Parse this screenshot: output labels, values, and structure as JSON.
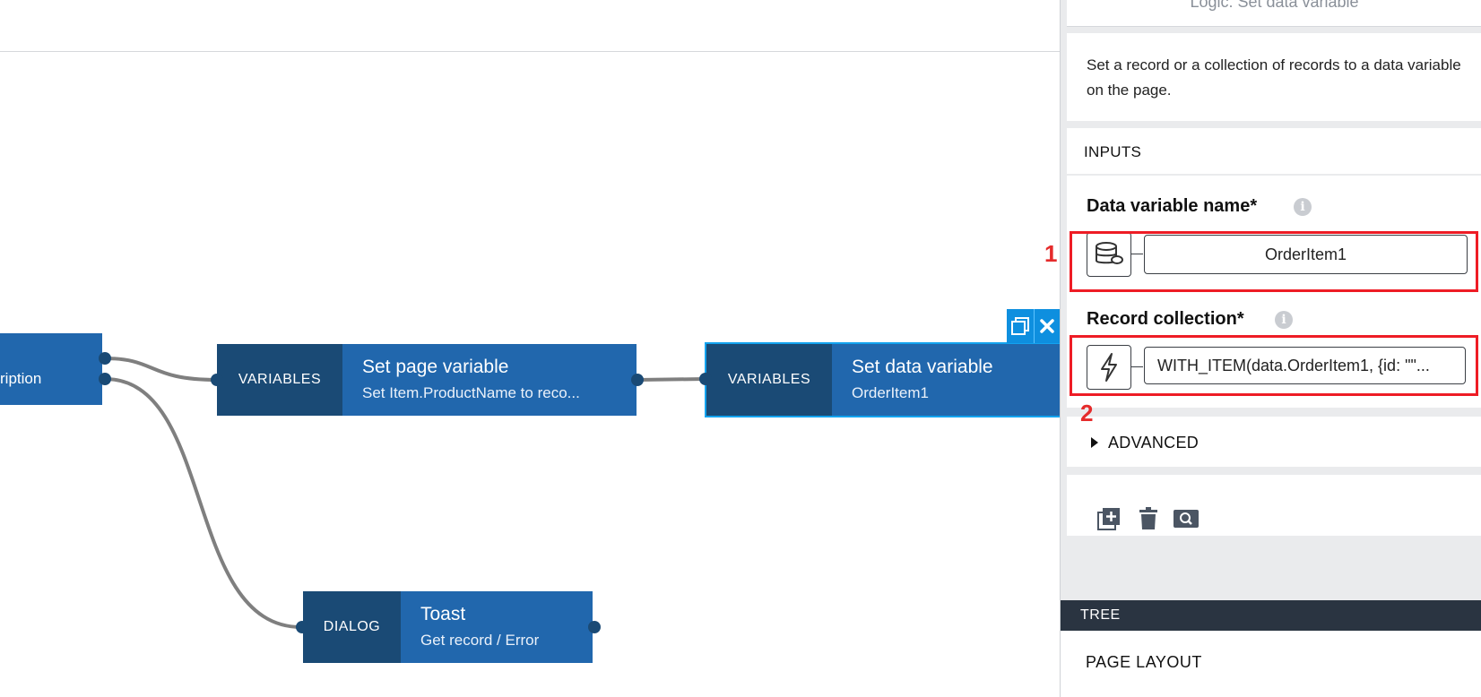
{
  "canvas": {
    "nodes": {
      "partial": {
        "label": "ription"
      },
      "page_var": {
        "category": "VARIABLES",
        "title": "Set page variable",
        "subtitle": "Set Item.ProductName to reco..."
      },
      "data_var": {
        "category": "VARIABLES",
        "title": "Set data variable",
        "subtitle": "OrderItem1"
      },
      "toast": {
        "category": "DIALOG",
        "title": "Toast",
        "subtitle": "Get record / Error"
      }
    },
    "node_tools": {
      "copy_icon": "copy-icon",
      "close_icon": "close-icon"
    }
  },
  "panel": {
    "header_title": "Logic: Set data variable",
    "description": "Set a record or a collection of records to a data variable on the page.",
    "inputs_label": "INPUTS",
    "fields": {
      "data_variable": {
        "label": "Data variable name*",
        "value": "OrderItem1",
        "icon": "database-icon"
      },
      "record_collection": {
        "label": "Record collection*",
        "value": "WITH_ITEM(data.OrderItem1, {id: \"\"...",
        "icon": "lightning-icon"
      }
    },
    "advanced_label": "ADVANCED",
    "toolbar": {
      "add_icon": "add-icon",
      "delete_icon": "trash-icon",
      "search_icon": "search-icon"
    },
    "tree_label": "TREE",
    "page_layout_label": "PAGE LAYOUT"
  },
  "annotations": {
    "one": "1",
    "two": "2"
  },
  "colors": {
    "node_blue": "#2167ad",
    "node_dark": "#1a4a75",
    "selected": "#13a3ef",
    "annotation_red": "#ee1c25",
    "tree_bar": "#2a3441"
  }
}
